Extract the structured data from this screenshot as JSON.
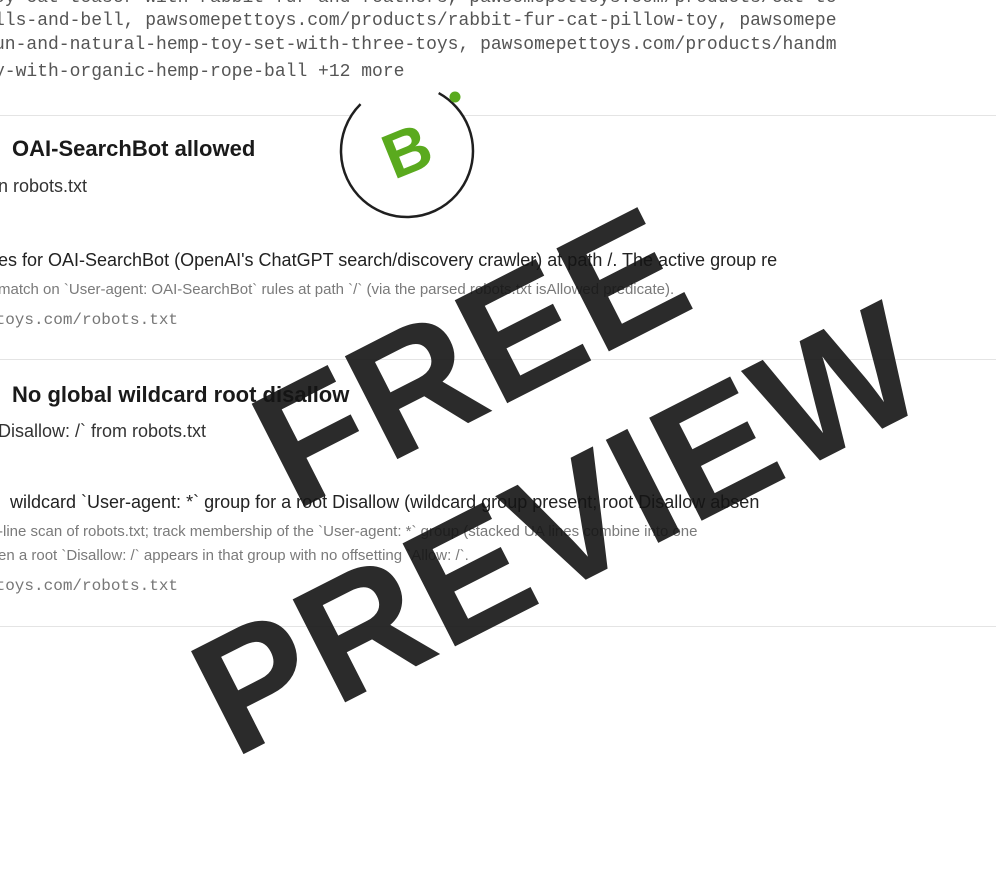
{
  "urls_block": {
    "line1": "oy-cat-teaser-with-rabbit-fur-and-feathers, pawsomepettoys.com/products/cat-te",
    "line2": "lls-and-bell, pawsomepettoys.com/products/rabbit-fur-cat-pillow-toy, pawsomepe",
    "line3": "un-and-natural-hemp-toy-set-with-three-toys, pawsomepettoys.com/products/handm",
    "line4": "y-with-organic-hemp-rope-ball +12 more"
  },
  "grade": {
    "letter": "B",
    "color": "#5aaa1e"
  },
  "checks": [
    {
      "title": "OAI-SearchBot allowed",
      "subtitle": "n robots.txt",
      "description": "es for OAI-SearchBot (OpenAI's ChatGPT search/discovery crawler) at path /. The active group re",
      "method": "match on `User-agent: OAI-SearchBot` rules at path `/` (via the parsed robots.txt isAllowed predicate).",
      "source": "ttoys.com/robots.txt"
    },
    {
      "title": "No global wildcard root disallow",
      "subtitle": "Disallow: /` from robots.txt",
      "description": "wildcard `User-agent: *` group for a root Disallow (wildcard group present; root Disallow absen",
      "method_line1": "-line scan of robots.txt; track membership of the `User-agent: *` group (stacked UA lines combine into one",
      "method_line2": "en a root `Disallow: /` appears in that group with no offsetting `Allow: /`.",
      "source": "ttoys.com/robots.txt"
    }
  ],
  "watermark": "FREE PREVIEW"
}
